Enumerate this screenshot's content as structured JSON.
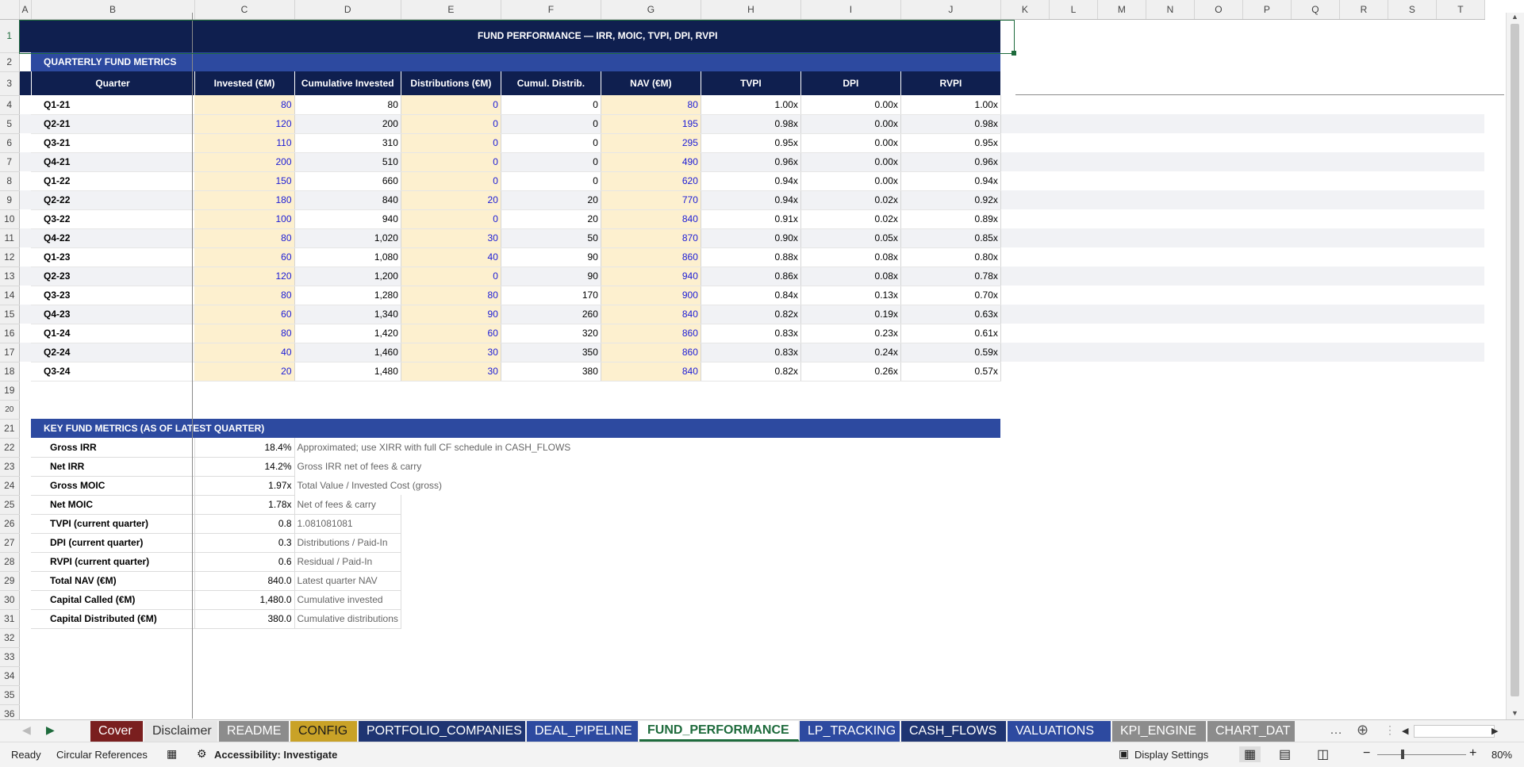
{
  "columns": [
    "A",
    "B",
    "C",
    "D",
    "E",
    "F",
    "G",
    "H",
    "I",
    "J",
    "K",
    "L",
    "M",
    "N",
    "O",
    "P",
    "Q",
    "R",
    "S",
    "T"
  ],
  "title": "FUND PERFORMANCE — IRR, MOIC, TVPI, DPI, RVPI",
  "section1": "QUARTERLY FUND METRICS",
  "headers": [
    "Quarter",
    "Invested (€M)",
    "Cumulative Invested",
    "Distributions (€M)",
    "Cumul. Distrib.",
    "NAV (€M)",
    "TVPI",
    "DPI",
    "RVPI"
  ],
  "quarters": [
    [
      "Q1-21",
      "80",
      "80",
      "0",
      "0",
      "80",
      "1.00x",
      "0.00x",
      "1.00x"
    ],
    [
      "Q2-21",
      "120",
      "200",
      "0",
      "0",
      "195",
      "0.98x",
      "0.00x",
      "0.98x"
    ],
    [
      "Q3-21",
      "110",
      "310",
      "0",
      "0",
      "295",
      "0.95x",
      "0.00x",
      "0.95x"
    ],
    [
      "Q4-21",
      "200",
      "510",
      "0",
      "0",
      "490",
      "0.96x",
      "0.00x",
      "0.96x"
    ],
    [
      "Q1-22",
      "150",
      "660",
      "0",
      "0",
      "620",
      "0.94x",
      "0.00x",
      "0.94x"
    ],
    [
      "Q2-22",
      "180",
      "840",
      "20",
      "20",
      "770",
      "0.94x",
      "0.02x",
      "0.92x"
    ],
    [
      "Q3-22",
      "100",
      "940",
      "0",
      "20",
      "840",
      "0.91x",
      "0.02x",
      "0.89x"
    ],
    [
      "Q4-22",
      "80",
      "1,020",
      "30",
      "50",
      "870",
      "0.90x",
      "0.05x",
      "0.85x"
    ],
    [
      "Q1-23",
      "60",
      "1,080",
      "40",
      "90",
      "860",
      "0.88x",
      "0.08x",
      "0.80x"
    ],
    [
      "Q2-23",
      "120",
      "1,200",
      "0",
      "90",
      "940",
      "0.86x",
      "0.08x",
      "0.78x"
    ],
    [
      "Q3-23",
      "80",
      "1,280",
      "80",
      "170",
      "900",
      "0.84x",
      "0.13x",
      "0.70x"
    ],
    [
      "Q4-23",
      "60",
      "1,340",
      "90",
      "260",
      "840",
      "0.82x",
      "0.19x",
      "0.63x"
    ],
    [
      "Q1-24",
      "80",
      "1,420",
      "60",
      "320",
      "860",
      "0.83x",
      "0.23x",
      "0.61x"
    ],
    [
      "Q2-24",
      "40",
      "1,460",
      "30",
      "350",
      "860",
      "0.83x",
      "0.24x",
      "0.59x"
    ],
    [
      "Q3-24",
      "20",
      "1,480",
      "30",
      "380",
      "840",
      "0.82x",
      "0.26x",
      "0.57x"
    ]
  ],
  "section2": "KEY FUND METRICS (AS OF LATEST QUARTER)",
  "metrics": [
    [
      "Gross IRR",
      "18.4%",
      "Approximated; use XIRR with full CF schedule in CASH_FLOWS"
    ],
    [
      "Net IRR",
      "14.2%",
      "Gross IRR net of fees & carry"
    ],
    [
      "Gross MOIC",
      "1.97x",
      "Total Value / Invested Cost (gross)"
    ],
    [
      "Net MOIC",
      "1.78x",
      "Net of fees & carry"
    ],
    [
      "TVPI (current quarter)",
      "0.8",
      "1.081081081"
    ],
    [
      "DPI (current quarter)",
      "0.3",
      "Distributions / Paid-In"
    ],
    [
      "RVPI (current quarter)",
      "0.6",
      "Residual / Paid-In"
    ],
    [
      "Total NAV (€M)",
      "840.0",
      "Latest quarter NAV"
    ],
    [
      "Capital Called (€M)",
      "1,480.0",
      "Cumulative invested"
    ],
    [
      "Capital Distributed (€M)",
      "380.0",
      "Cumulative distributions"
    ]
  ],
  "sheet_tabs": [
    {
      "label": "Cover",
      "color": "#7a1f1f"
    },
    {
      "label": "Disclaimer",
      "color": "#e6e6e6"
    },
    {
      "label": "README",
      "color": "#8c8c8c"
    },
    {
      "label": "CONFIG",
      "color": "#c9a227"
    },
    {
      "label": "PORTFOLIO_COMPANIES",
      "color": "#1f3572"
    },
    {
      "label": "DEAL_PIPELINE",
      "color": "#2d4aa0"
    },
    {
      "label": "FUND_PERFORMANCE",
      "color": "#ffffff",
      "active": true
    },
    {
      "label": "LP_TRACKING",
      "color": "#2d4aa0"
    },
    {
      "label": "CASH_FLOWS",
      "color": "#1f3572"
    },
    {
      "label": "VALUATIONS",
      "color": "#2d4aa0"
    },
    {
      "label": "KPI_ENGINE",
      "color": "#8c8c8c"
    },
    {
      "label": "CHART_DAT",
      "color": "#8c8c8c"
    }
  ],
  "status": {
    "ready": "Ready",
    "circular": "Circular References",
    "accessibility": "Accessibility: Investigate",
    "display": "Display Settings",
    "zoom": "80%"
  }
}
